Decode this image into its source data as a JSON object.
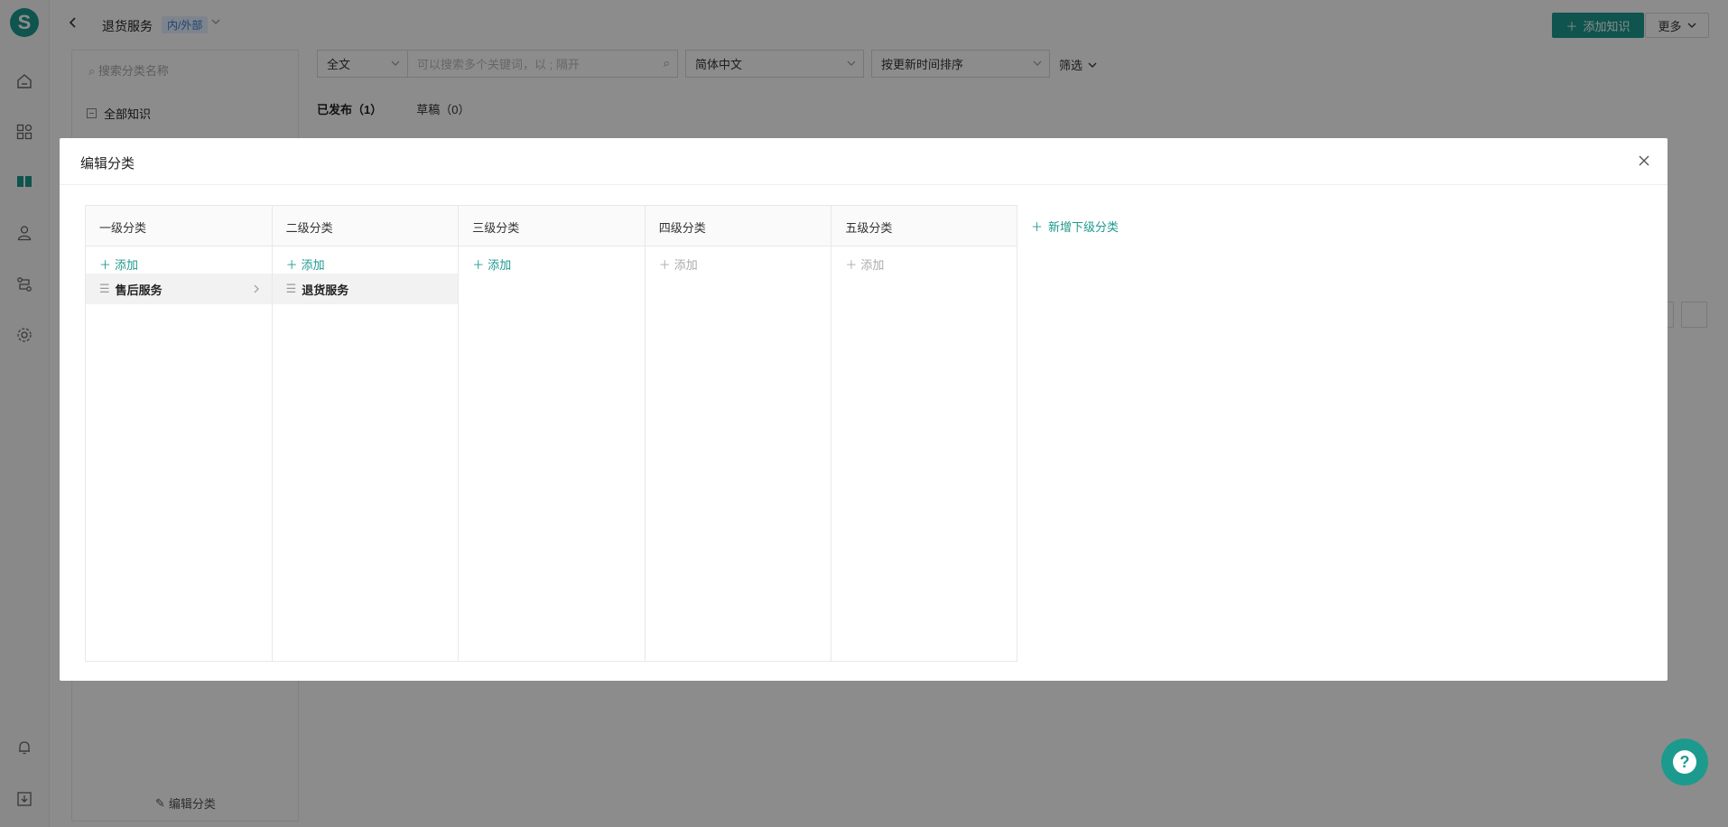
{
  "colors": {
    "accent": "#1d9a8e",
    "tag_bg": "#e6f0ff",
    "tag_fg": "#3a7bd5"
  },
  "rail": {
    "logo": "S",
    "icons": [
      "home-icon",
      "apps-icon",
      "book-icon",
      "user-icon",
      "flow-icon",
      "gear-icon",
      "bell-icon",
      "download-icon"
    ]
  },
  "header": {
    "title": "退货服务",
    "tag": "内/外部",
    "add_button": "添加知识",
    "more_button": "更多"
  },
  "category_panel": {
    "search_placeholder": "搜索分类名称",
    "all_knowledge": "全部知识",
    "edit_category": "编辑分类"
  },
  "toolbar": {
    "scope": "全文",
    "search_placeholder": "可以搜索多个关键词，以 ; 隔开",
    "language": "简体中文",
    "sort": "按更新时间排序",
    "filter": "筛选"
  },
  "tabs": [
    {
      "label": "已发布（1）"
    },
    {
      "label": "草稿（0）"
    }
  ],
  "modal": {
    "title": "编辑分类",
    "add_level": "新增下级分类",
    "levels": [
      {
        "header": "一级分类",
        "add": "添加",
        "enabled": true,
        "items": [
          "售后服务"
        ]
      },
      {
        "header": "二级分类",
        "add": "添加",
        "enabled": true,
        "items": [
          "退货服务"
        ]
      },
      {
        "header": "三级分类",
        "add": "添加",
        "enabled": true,
        "items": []
      },
      {
        "header": "四级分类",
        "add": "添加",
        "enabled": false,
        "items": []
      },
      {
        "header": "五级分类",
        "add": "添加",
        "enabled": false,
        "items": []
      }
    ]
  }
}
